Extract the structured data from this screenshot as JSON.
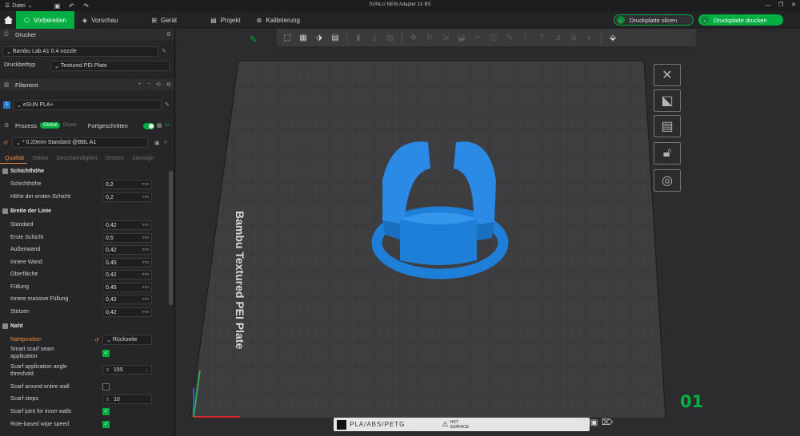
{
  "window": {
    "menu_label": "Datei",
    "title": "SUNLU NEW Adapter 1X BS"
  },
  "tabs": [
    {
      "label": "Vorbereiten",
      "icon": "cube-icon"
    },
    {
      "label": "Vorschau",
      "icon": "layers-icon"
    },
    {
      "label": "Gerät",
      "icon": "device-icon"
    },
    {
      "label": "Projekt",
      "icon": "project-icon"
    },
    {
      "label": "Kalibrierung",
      "icon": "calibration-icon"
    }
  ],
  "actions": {
    "slice_label": "Druckplatte slicen",
    "print_label": "Druckplatte drucken"
  },
  "printer": {
    "section_title": "Drucker",
    "name": "Bambu Lab A1 0.4 nozzle",
    "bed_type_label": "Druckbetttyp",
    "bed_type_value": "Textured PEI Plate"
  },
  "filament": {
    "section_title": "Filament",
    "slot_number": "1",
    "name": "eSUN PLA+"
  },
  "process": {
    "section_title": "Prozess",
    "global_label": "Global",
    "object_label": "Objekt",
    "advanced_label": "Fortgeschritten",
    "profile": "* 0.20mm Standard @BBL A1",
    "tabs": [
      "Qualität",
      "Stärke",
      "Geschwindigkeit",
      "Stützen",
      "Sonstige"
    ],
    "active_tab": "Qualität"
  },
  "settings": {
    "layer_height": {
      "title": "Schichthöhe",
      "rows": [
        {
          "label": "Schichthöhe",
          "value": "0,2",
          "unit": "mm"
        },
        {
          "label": "Höhe der ersten Schicht",
          "value": "0,2",
          "unit": "mm"
        }
      ]
    },
    "line_width": {
      "title": "Breite der Linie",
      "rows": [
        {
          "label": "Standard",
          "value": "0,42",
          "unit": "mm"
        },
        {
          "label": "Erste Schicht",
          "value": "0,5",
          "unit": "mm"
        },
        {
          "label": "Außenwand",
          "value": "0,42",
          "unit": "mm"
        },
        {
          "label": "Innere Wand",
          "value": "0,45",
          "unit": "mm"
        },
        {
          "label": "Oberfläche",
          "value": "0,42",
          "unit": "mm"
        },
        {
          "label": "Füllung",
          "value": "0,45",
          "unit": "mm"
        },
        {
          "label": "Innere massive Füllung",
          "value": "0,42",
          "unit": "mm"
        },
        {
          "label": "Stützen",
          "value": "0,42",
          "unit": "mm"
        }
      ]
    },
    "seam": {
      "title": "Naht",
      "position_label": "Nahtposition",
      "position_value": "Rückseite",
      "smart_scarf_label_1": "Smart scarf seam",
      "smart_scarf_label_2": "application",
      "smart_scarf_checked": true,
      "angle_label_1": "Scarf application angle",
      "angle_label_2": "threshold",
      "angle_value": "155",
      "entire_wall_label": "Scarf around entire wall",
      "entire_wall_checked": false,
      "steps_label": "Scarf steps",
      "steps_value": "10",
      "inner_walls_label": "Scarf joint for inner walls",
      "inner_walls_checked": true,
      "wipe_label": "Role-based wipe speed",
      "wipe_checked": true
    }
  },
  "viewport": {
    "plate_label": "Bambu Textured PEI Plate",
    "bottom_label": "PLA/ABS/PETG",
    "hot_label_1": "HOT",
    "hot_label_2": "SURFACE",
    "plate_number": "01",
    "model_color": "#1e7fd8"
  }
}
